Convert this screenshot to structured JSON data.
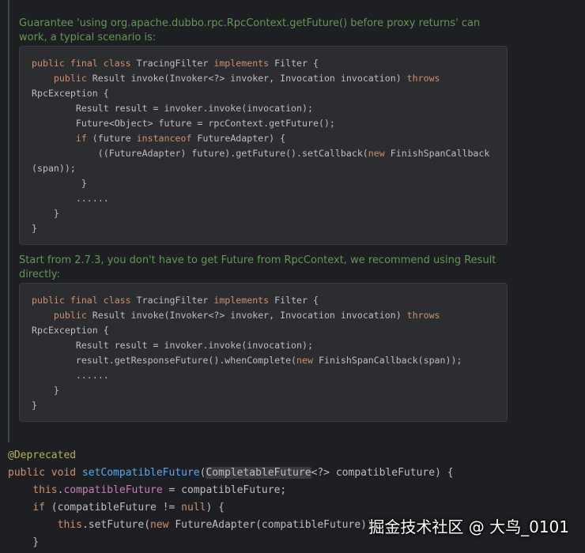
{
  "doc": {
    "para1": "Guarantee 'using org.apache.dubbo.rpc.RpcContext.getFuture() before proxy returns' can work, a typical scenario is:",
    "para2": "Start from 2.7.3, you don't have to get Future from RpcContext, we recommend using Result directly:"
  },
  "example1": {
    "l1": {
      "kw1": "public final class",
      "name": " TracingFilter ",
      "kw2": "implements",
      "rest": " Filter {"
    },
    "l2": {
      "indent": "    ",
      "kw": "public",
      "rest": " Result invoke(Invoker<?> invoker, Invocation invocation) ",
      "kw2": "throws"
    },
    "l3": "RpcException {",
    "l4": "        Result result = invoker.invoke(invocation);",
    "l5": "        Future<Object> future = rpcContext.getFuture();",
    "l6": {
      "indent": "        ",
      "kw": "if",
      "mid": " (future ",
      "kw2": "instanceof",
      "rest": " FutureAdapter) {"
    },
    "l7": {
      "pre": "            ((FutureAdapter) future).getFuture().setCallback(",
      "kw": "new",
      "rest": " FinishSpanCallback"
    },
    "l8": "(span));",
    "l9": "         }",
    "l10": "        ......",
    "l11": "    }",
    "l12": "}"
  },
  "example2": {
    "l1": {
      "kw1": "public final class",
      "name": " TracingFilter ",
      "kw2": "implements",
      "rest": " Filter {"
    },
    "l2": {
      "indent": "    ",
      "kw": "public",
      "rest": " Result invoke(Invoker<?> invoker, Invocation invocation) ",
      "kw2": "throws"
    },
    "l3": "RpcException {",
    "l4": "        Result result = invoker.invoke(invocation);",
    "l5": {
      "pre": "        result.getResponseFuture().whenComplete(",
      "kw": "new",
      "rest": " FinishSpanCallback(span));"
    },
    "l6": "        ......",
    "l7": "    }",
    "l8": "}"
  },
  "editor": {
    "annotation": "@Deprecated",
    "sig": {
      "kw": "public void",
      "method": "setCompatibleFuture",
      "open": "(",
      "type": "CompletableFuture",
      "rest": "<?> compatibleFuture) {"
    },
    "line2": {
      "indent": "    ",
      "kw": "this",
      "dot": ".",
      "field": "compatibleFuture",
      "rest": " = compatibleFuture;"
    },
    "line3": {
      "indent": "    ",
      "kw": "if",
      "mid": " (compatibleFuture != ",
      "kw2": "null",
      "rest": ") {"
    },
    "line4": {
      "indent": "        ",
      "kw": "this",
      "mid": ".setFuture(",
      "kw2": "new",
      "rest": " FutureAdapter(compatibleFuture));"
    },
    "line5": "    }"
  },
  "watermark": "掘金技术社区 @ 大鸟_0101"
}
